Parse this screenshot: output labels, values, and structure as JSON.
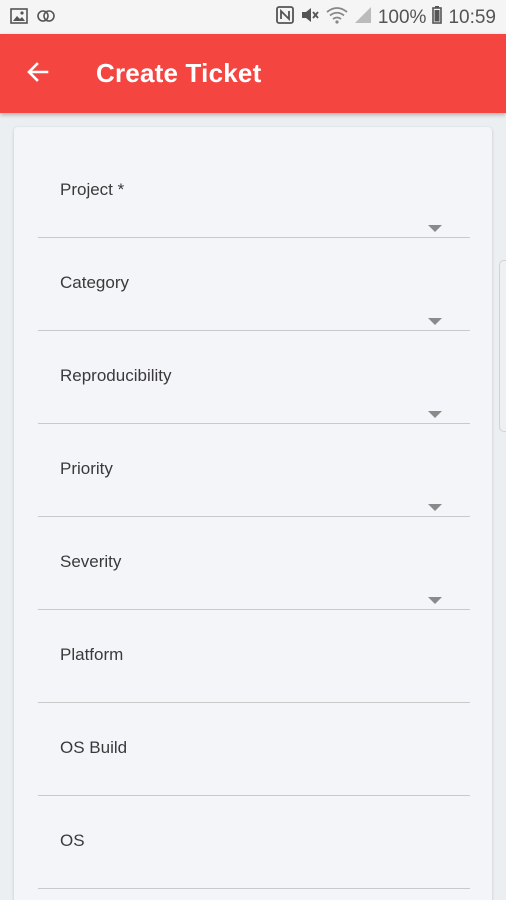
{
  "status_bar": {
    "battery": "100%",
    "time": "10:59",
    "icons": [
      "image-icon",
      "cast-icon",
      "nfc-icon",
      "mute-icon",
      "wifi-icon",
      "signal-icon",
      "battery-icon"
    ]
  },
  "app_bar": {
    "title": "Create Ticket",
    "back_icon": "arrow-back-icon",
    "color": "#f44540"
  },
  "form": {
    "fields": [
      {
        "label": "Project *",
        "type": "dropdown"
      },
      {
        "label": "Category",
        "type": "dropdown"
      },
      {
        "label": "Reproducibility",
        "type": "dropdown"
      },
      {
        "label": "Priority",
        "type": "dropdown"
      },
      {
        "label": "Severity",
        "type": "dropdown"
      },
      {
        "label": "Platform",
        "type": "text"
      },
      {
        "label": "OS Build",
        "type": "text"
      },
      {
        "label": "OS",
        "type": "text"
      }
    ]
  }
}
